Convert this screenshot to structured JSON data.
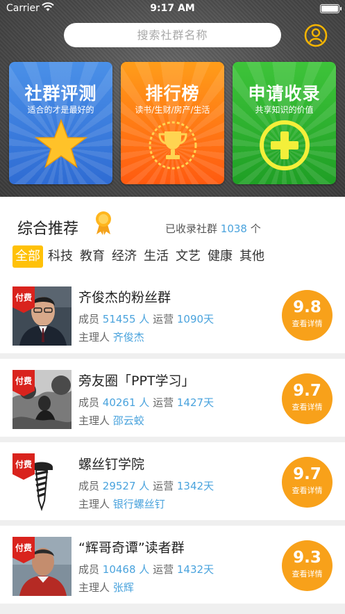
{
  "status_bar": {
    "carrier": "Carrier",
    "time": "9:17 AM"
  },
  "search": {
    "placeholder": "搜索社群名称"
  },
  "tiles": [
    {
      "title": "社群评测",
      "subtitle": "适合的才是最好的",
      "icon": "star-icon"
    },
    {
      "title": "排行榜",
      "subtitle": "读书/生财/房产/生活",
      "icon": "trophy-icon"
    },
    {
      "title": "申请收录",
      "subtitle": "共享知识的价值",
      "icon": "plus-circle-icon"
    }
  ],
  "recommend": {
    "title": "综合推荐",
    "count_prefix": "已收录社群",
    "count": "1038",
    "count_suffix": "个",
    "categories": [
      "全部",
      "科技",
      "教育",
      "经济",
      "生活",
      "文艺",
      "健康",
      "其他"
    ],
    "active_category": "全部"
  },
  "labels": {
    "members": "成员",
    "person_unit": "人",
    "operating": "运营",
    "days_unit": "天",
    "host": "主理人",
    "paid": "付费",
    "detail": "查看详情"
  },
  "groups": [
    {
      "name": "齐俊杰的粉丝群",
      "members": "51455",
      "days": "1090",
      "host": "齐俊杰",
      "score": "9.8"
    },
    {
      "name": "旁友圈「PPT学习」",
      "members": "40261",
      "days": "1427",
      "host": "邵云蛟",
      "score": "9.7"
    },
    {
      "name": "螺丝钉学院",
      "members": "29527",
      "days": "1342",
      "host": "银行螺丝钉",
      "score": "9.7"
    },
    {
      "name": "“辉哥奇谭”读者群",
      "members": "10468",
      "days": "1432",
      "host": "张辉",
      "score": "9.3"
    }
  ],
  "colors": {
    "accent_blue": "#4aa3dd",
    "score_orange": "#f8a11a",
    "category_active": "#ffc107",
    "paid_red": "#d9231d"
  }
}
